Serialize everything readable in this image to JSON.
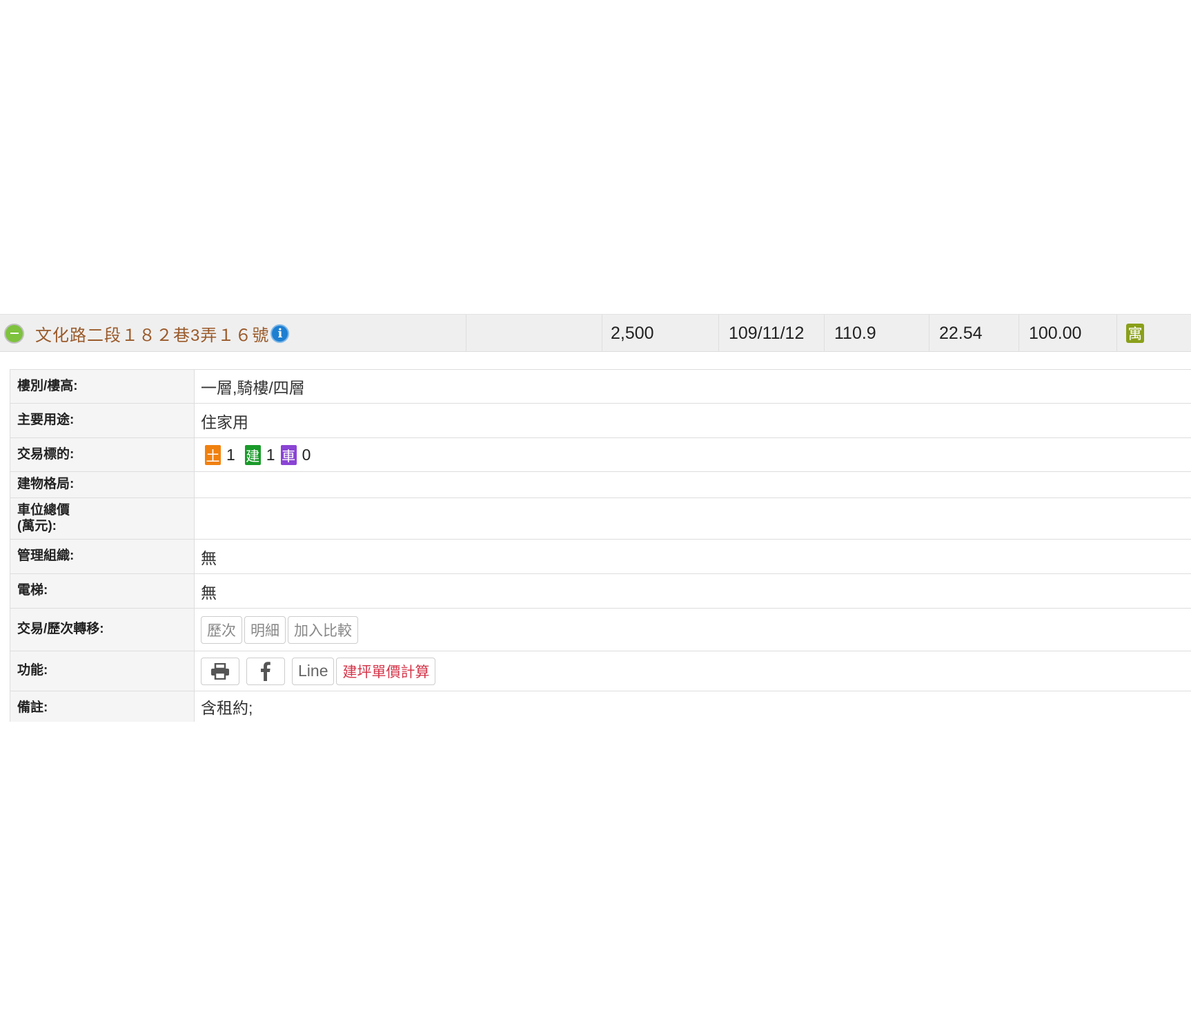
{
  "record": {
    "address": "文化路二段１８２巷3弄１６號",
    "price": "2,500",
    "date": "109/11/12",
    "area": "110.9",
    "unit_price": "22.54",
    "ratio": "100.00",
    "type_badge": "寓"
  },
  "details": {
    "floor_label": "樓別/樓高:",
    "floor_value": "一層,騎樓/四層",
    "usage_label": "主要用途:",
    "usage_value": "住家用",
    "target_label": "交易標的:",
    "targets": [
      {
        "badge": "土",
        "count": "1",
        "color": "#f0810f"
      },
      {
        "badge": "建",
        "count": "1",
        "color": "#1a9a2a"
      },
      {
        "badge": "車",
        "count": "0",
        "color": "#8a44d4"
      }
    ],
    "layout_label": "建物格局:",
    "layout_value": "",
    "parking_label_line1": "車位總價",
    "parking_label_line2": "(萬元):",
    "parking_value": "",
    "mgmt_label": "管理組織:",
    "mgmt_value": "無",
    "elevator_label": "電梯:",
    "elevator_value": "無",
    "transfer_label": "交易/歷次轉移:",
    "transfer_buttons": [
      "歷次",
      "明細",
      "加入比較"
    ],
    "function_label": "功能:",
    "line_button": "Line",
    "calc_button": "建坪單價計算",
    "notes_label": "備註:",
    "notes_value": "含租約;"
  },
  "icons": {
    "collapse": "minus-circle-icon",
    "info": "info-icon",
    "print": "print-icon",
    "facebook": "facebook-icon"
  }
}
